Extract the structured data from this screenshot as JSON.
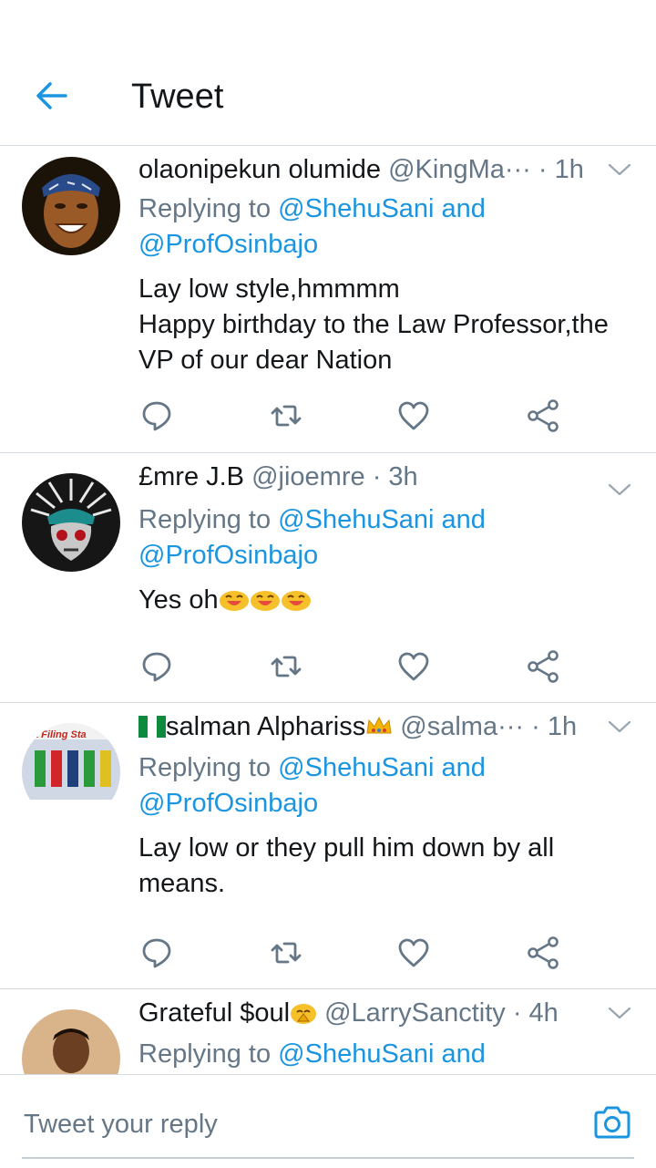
{
  "header": {
    "title": "Tweet"
  },
  "colors": {
    "accent": "#1b95e0",
    "secondary_text": "#657786",
    "divider": "#d6dbdf"
  },
  "tweets": [
    {
      "name": "olaonipekun olumide",
      "handle": "@KingMa···",
      "time": "· 1h",
      "replying_prefix": "Replying to ",
      "mention1": "@ShehuSani and",
      "mention2": "@ProfOsinbajo",
      "body_lines": [
        "Lay low style,hmmmm",
        "Happy birthday to the Law Professor,the",
        "VP of our dear Nation"
      ]
    },
    {
      "name": "£mre J.B",
      "handle": "@jioemre",
      "time": "· 3h",
      "replying_prefix": "Replying to ",
      "mention1": "@ShehuSani and",
      "mention2": "@ProfOsinbajo",
      "body": "Yes oh",
      "emoji": "smiling-face-emoji ×3"
    },
    {
      "name": "salman Alphariss",
      "name_prefix_icon": "nigeria-flag-emoji",
      "name_suffix_icon": "crown-emoji",
      "handle": "@salma···",
      "time": "· 1h",
      "avatar_text": "a Filing Sta",
      "replying_prefix": "Replying to ",
      "mention1": "@ShehuSani and",
      "mention2": "@ProfOsinbajo",
      "body_lines": [
        "Lay low or they pull him down by all",
        "means."
      ]
    },
    {
      "name": "Grateful $oul",
      "name_suffix_icon": "praying-hands-emoji",
      "handle": "@LarrySanctity",
      "time": "· 4h",
      "replying_prefix": "Replying to ",
      "mention1": "@ShehuSani and"
    }
  ],
  "composer": {
    "placeholder": "Tweet your reply"
  }
}
